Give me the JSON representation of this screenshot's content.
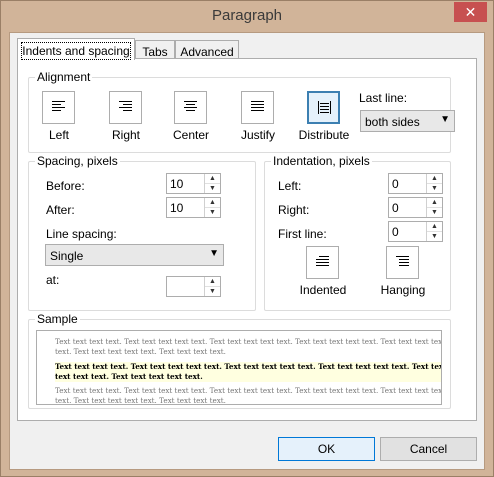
{
  "window": {
    "title": "Paragraph",
    "close": "✕"
  },
  "tabs": [
    "Indents and spacing",
    "Tabs",
    "Advanced"
  ],
  "alignment": {
    "group": "Alignment",
    "buttons": [
      "Left",
      "Right",
      "Center",
      "Justify",
      "Distribute"
    ],
    "selected": "Distribute",
    "last_line_label": "Last line:",
    "last_line_value": "both sides"
  },
  "spacing": {
    "group": "Spacing, pixels",
    "before_label": "Before:",
    "before_value": "10",
    "after_label": "After:",
    "after_value": "10",
    "line_spacing_label": "Line spacing:",
    "line_spacing_value": "Single",
    "at_label": "at:",
    "at_value": ""
  },
  "indentation": {
    "group": "Indentation, pixels",
    "left_label": "Left:",
    "left_value": "0",
    "right_label": "Right:",
    "right_value": "0",
    "first_line_label": "First line:",
    "first_line_value": "0",
    "indented_label": "Indented",
    "hanging_label": "Hanging"
  },
  "sample": {
    "group": "Sample",
    "line1": "Text text text text. Text text text text text. Text text text text text. Text text text text text. Text text text text text. Text text text text text. Text text text text.",
    "line2": "Text text text text. Text text text text text. Text text text text text. Text text text text text. Text text text text text. Text text text text text.",
    "line3": "Text text text text. Text text text text text. Text text text text text. Text text text text text. Text text text text text. Text text text text text. Text text text text."
  },
  "buttons": {
    "ok": "OK",
    "cancel": "Cancel"
  }
}
